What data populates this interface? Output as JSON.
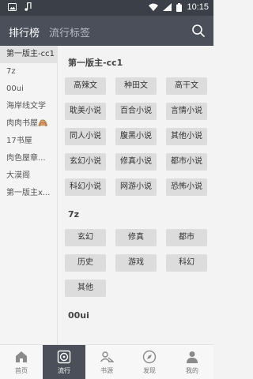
{
  "statusbar": {
    "time": "10:15"
  },
  "header": {
    "tabs": [
      {
        "label": "排行榜"
      },
      {
        "label": "流行标签"
      }
    ]
  },
  "sidebar": {
    "items": [
      {
        "label": "第一版主-cc1"
      },
      {
        "label": "7z"
      },
      {
        "label": "00ui"
      },
      {
        "label": "海岸线文学"
      },
      {
        "label": "肉肉书屋🙈"
      },
      {
        "label": "17书屋"
      },
      {
        "label": "肉色屋章..."
      },
      {
        "label": "大漠阁"
      },
      {
        "label": "第一版主x..."
      }
    ]
  },
  "main": {
    "sections": [
      {
        "title": "第一版主-cc1",
        "tags": [
          "高辣文",
          "种田文",
          "高干文",
          "耽美小说",
          "百合小说",
          "言情小说",
          "同人小说",
          "腹黑小说",
          "其他小说",
          "玄幻小说",
          "修真小说",
          "都市小说",
          "科幻小说",
          "网游小说",
          "恐怖小说"
        ]
      },
      {
        "title": "7z",
        "tags": [
          "玄幻",
          "修真",
          "都市",
          "历史",
          "游戏",
          "科幻",
          "其他"
        ]
      },
      {
        "title": "00ui",
        "tags": []
      }
    ]
  },
  "bottom_nav": {
    "items": [
      {
        "label": "首页",
        "icon": "home-icon"
      },
      {
        "label": "流行",
        "icon": "disc-icon"
      },
      {
        "label": "书源",
        "icon": "book-source-icon"
      },
      {
        "label": "发现",
        "icon": "compass-icon"
      },
      {
        "label": "我的",
        "icon": "profile-icon"
      }
    ]
  },
  "colors": {
    "statusbar": "#3a3f48",
    "topbar": "#4a4f59",
    "tag_bg": "#dcdcdc",
    "page_bg": "#f3f3f3"
  }
}
